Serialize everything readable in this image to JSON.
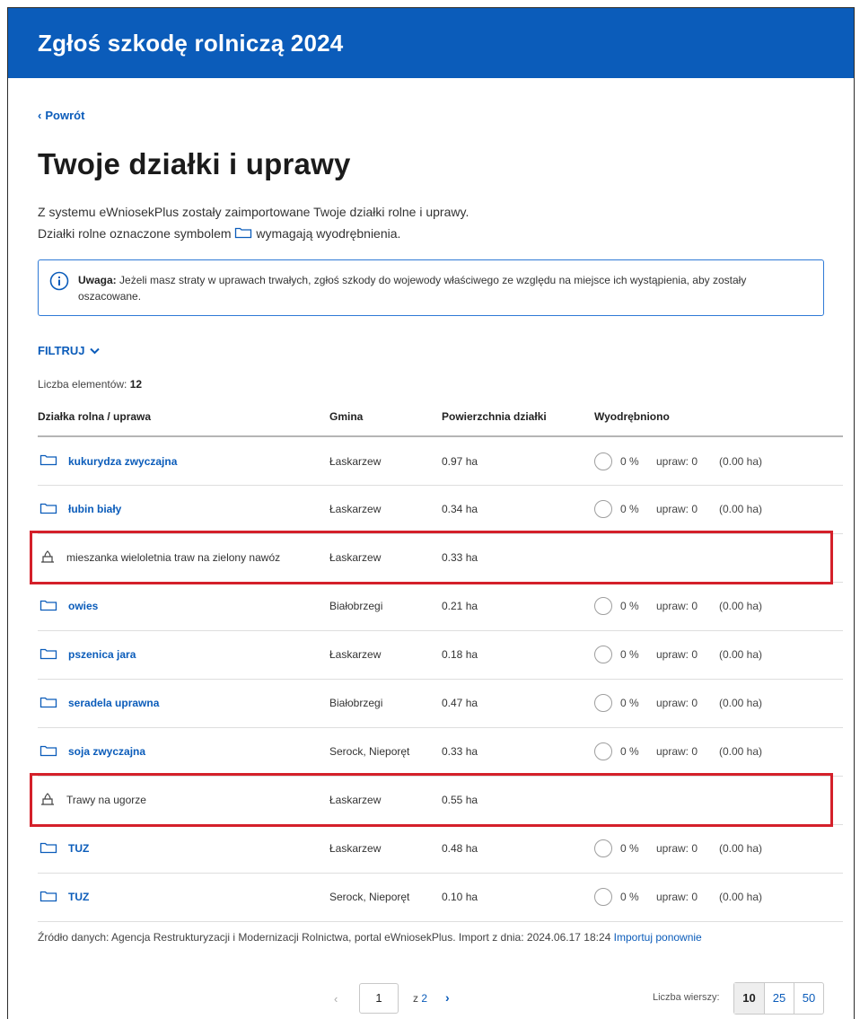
{
  "header": {
    "title": "Zgłoś szkodę rolniczą 2024",
    "color": "#0b5cba"
  },
  "nav": {
    "back_label": "Powrót"
  },
  "page": {
    "title": "Twoje działki i uprawy",
    "intro_line1": "Z systemu eWniosekPlus zostały zaimportowane Twoje działki rolne i uprawy.",
    "intro_line2_before": "Działki rolne oznaczone symbolem",
    "intro_line2_after": "wymagają wyodrębnienia."
  },
  "alert": {
    "label": "Uwaga:",
    "text": "Jeżeli masz straty w uprawach trwałych, zgłoś szkody do wojewody właściwego ze względu na miejsce ich wystąpienia, aby zostały oszacowane."
  },
  "filter": {
    "label": "FILTRUJ"
  },
  "count": {
    "label": "Liczba elementów:",
    "value": "12"
  },
  "table": {
    "headers": [
      "Działka rolna / uprawa",
      "Gmina",
      "Powierzchnia działki",
      "Wyodrębniono"
    ],
    "upraw_label": "upraw:",
    "rows": [
      {
        "icon": "folder-icon",
        "name": "kukurydza zwyczajna",
        "gmina": "Łaskarzew",
        "area": "0.97 ha",
        "pct": "0 %",
        "upraw": "0",
        "ha": "(0.00 ha)",
        "link": true,
        "highlighted": false
      },
      {
        "icon": "folder-icon",
        "name": "łubin biały",
        "gmina": "Łaskarzew",
        "area": "0.34 ha",
        "pct": "0 %",
        "upraw": "0",
        "ha": "(0.00 ha)",
        "link": true,
        "highlighted": false
      },
      {
        "icon": "crop-icon",
        "name": "mieszanka wieloletnia traw na zielony nawóz",
        "gmina": "Łaskarzew",
        "area": "0.33 ha",
        "pct": "",
        "upraw": "",
        "ha": "",
        "link": false,
        "highlighted": true
      },
      {
        "icon": "folder-icon",
        "name": "owies",
        "gmina": "Białobrzegi",
        "area": "0.21 ha",
        "pct": "0 %",
        "upraw": "0",
        "ha": "(0.00 ha)",
        "link": true,
        "highlighted": false
      },
      {
        "icon": "folder-icon",
        "name": "pszenica jara",
        "gmina": "Łaskarzew",
        "area": "0.18 ha",
        "pct": "0 %",
        "upraw": "0",
        "ha": "(0.00 ha)",
        "link": true,
        "highlighted": false
      },
      {
        "icon": "folder-icon",
        "name": "seradela uprawna",
        "gmina": "Białobrzegi",
        "area": "0.47 ha",
        "pct": "0 %",
        "upraw": "0",
        "ha": "(0.00 ha)",
        "link": true,
        "highlighted": false
      },
      {
        "icon": "folder-icon",
        "name": "soja zwyczajna",
        "gmina": "Serock, Nieporęt",
        "area": "0.33 ha",
        "pct": "0 %",
        "upraw": "0",
        "ha": "(0.00 ha)",
        "link": true,
        "highlighted": false
      },
      {
        "icon": "crop-icon",
        "name": "Trawy na ugorze",
        "gmina": "Łaskarzew",
        "area": "0.55 ha",
        "pct": "",
        "upraw": "",
        "ha": "",
        "link": false,
        "highlighted": true
      },
      {
        "icon": "folder-icon",
        "name": "TUZ",
        "gmina": "Łaskarzew",
        "area": "0.48 ha",
        "pct": "0 %",
        "upraw": "0",
        "ha": "(0.00 ha)",
        "link": true,
        "highlighted": false
      },
      {
        "icon": "folder-icon",
        "name": "TUZ",
        "gmina": "Serock, Nieporęt",
        "area": "0.10 ha",
        "pct": "0 %",
        "upraw": "0",
        "ha": "(0.00 ha)",
        "link": true,
        "highlighted": false
      }
    ]
  },
  "source": {
    "text": "Źródło danych: Agencja Restrukturyzacji i Modernizacji Rolnictwa, portal eWniosekPlus. Import z dnia: 2024.06.17 18:24",
    "reimport_label": "Importuj ponownie"
  },
  "pagination": {
    "current_page": "1",
    "of_label": "z",
    "total_pages": "2",
    "rows_label": "Liczba wierszy:",
    "row_options": [
      "10",
      "25",
      "50"
    ],
    "selected_rows": "10"
  },
  "colors": {
    "accent": "#0b5cba",
    "highlight": "#d4202a"
  }
}
